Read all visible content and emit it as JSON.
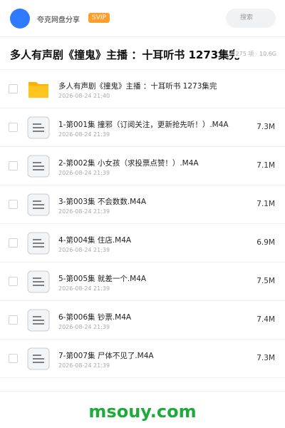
{
  "header": {
    "share_name": "夸克网盘分享",
    "badge": "SVIP",
    "search_placeholder": "搜索"
  },
  "folder": {
    "title": "多人有声剧《撞鬼》主播 ：十耳听书 1273集完",
    "meta": "275 项 · 10.6G"
  },
  "files": [
    {
      "name": "多人有声剧《撞鬼》主播 ：十耳听书 1273集完",
      "date": "2026-08-24 21:40",
      "size": "",
      "type": "folder"
    },
    {
      "name": "1-第001集 撞邪（订阅关注，更新抢先听！）.M4A",
      "date": "2026-08-24 21:39",
      "size": "7.3M",
      "type": "file"
    },
    {
      "name": "2-第002集 小女孩（求投票点赞！）.M4A",
      "date": "2026-08-24 21:39",
      "size": "7.1M",
      "type": "file"
    },
    {
      "name": "3-第003集 不会数数.M4A",
      "date": "2026-08-24 21:39",
      "size": "7.1M",
      "type": "file"
    },
    {
      "name": "4-第004集 住店.M4A",
      "date": "2026-08-24 21:39",
      "size": "6.9M",
      "type": "file"
    },
    {
      "name": "5-第005集 就差一个.M4A",
      "date": "2026-08-24 21:39",
      "size": "7.5M",
      "type": "file"
    },
    {
      "name": "6-第006集 钞票.M4A",
      "date": "2026-08-24 21:39",
      "size": "7.4M",
      "type": "file"
    },
    {
      "name": "7-第007集 尸体不见了.M4A",
      "date": "2026-08-24 21:39",
      "size": "7.3M",
      "type": "file"
    }
  ],
  "footer": {
    "watermark": "msouy.com"
  },
  "colors": {
    "accent": "#2f7bff",
    "svip": "#ff9e2c",
    "folder": "#ffc41f",
    "watermark": "#1faa3c"
  }
}
